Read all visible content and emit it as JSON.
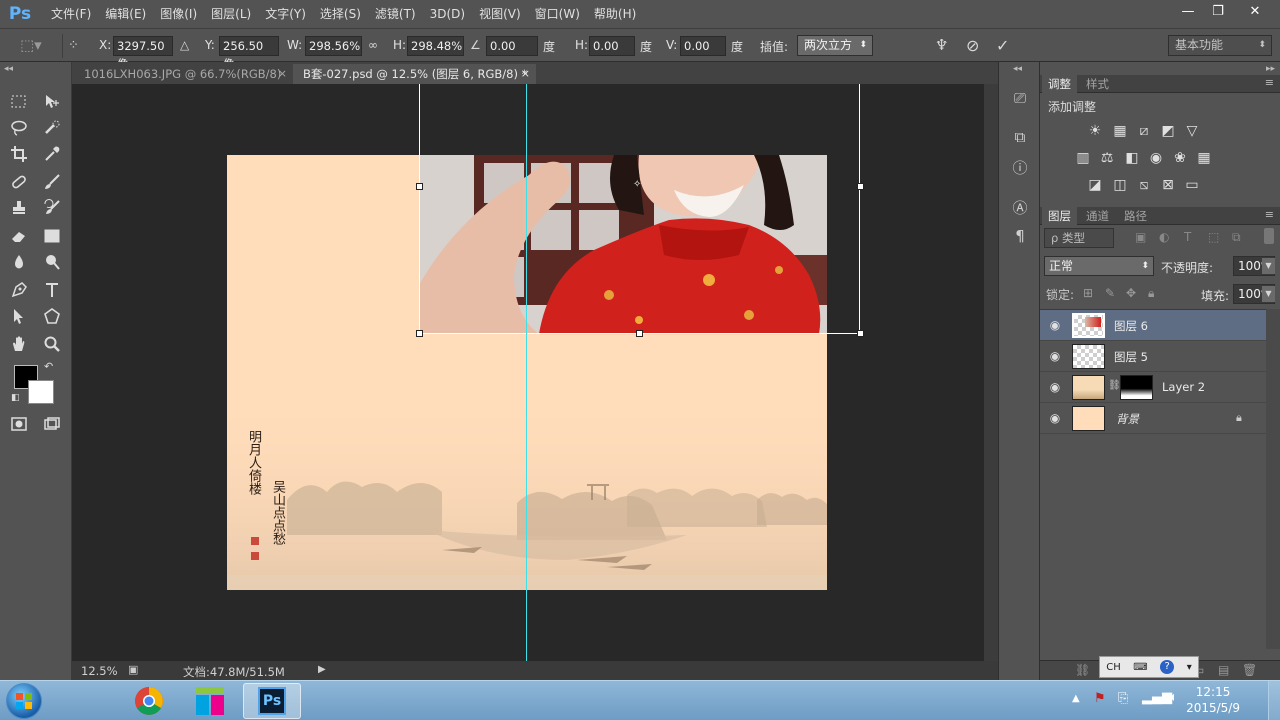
{
  "app": {
    "logo": "Ps",
    "menus": [
      "文件(F)",
      "编辑(E)",
      "图像(I)",
      "图层(L)",
      "文字(Y)",
      "选择(S)",
      "滤镜(T)",
      "3D(D)",
      "视图(V)",
      "窗口(W)",
      "帮助(H)"
    ],
    "window_controls": {
      "minimize": "—",
      "restore": "❐",
      "close": "✕"
    }
  },
  "options_bar": {
    "x_label": "X:",
    "x_value": "3297.50 像",
    "y_label": "Y:",
    "y_value": "256.50 像",
    "w_label": "W:",
    "w_value": "298.56%",
    "h_label": "H:",
    "h_value": "298.48%",
    "angle_value": "0.00",
    "angle_unit": "度",
    "hskew_label": "H:",
    "hskew_value": "0.00",
    "hskew_unit": "度",
    "vskew_label": "V:",
    "vskew_value": "0.00",
    "vskew_unit": "度",
    "interp_label": "插值:",
    "interp_value": "两次立方",
    "workspace": "基本功能"
  },
  "tabs": [
    {
      "label": "1016LXH063.JPG @ 66.7%(RGB/8)",
      "close": "×",
      "active": false
    },
    {
      "label": "B套-027.psd @ 12.5% (图层 6, RGB/8) *",
      "close": "×",
      "active": true
    }
  ],
  "document": {
    "calligraphy_left": "明月人倚楼",
    "calligraphy_right": "吴山点点愁"
  },
  "status": {
    "zoom": "12.5%",
    "doc_size": "文档:47.8M/51.5M"
  },
  "adjustments_panel": {
    "tabs": [
      "调整",
      "样式"
    ],
    "title": "添加调整"
  },
  "layers_panel": {
    "tabs": [
      "图层",
      "通道",
      "路径"
    ],
    "filter_label": "ρ 类型",
    "blend_mode": "正常",
    "opacity_label": "不透明度:",
    "opacity_value": "100%",
    "lock_label": "锁定:",
    "fill_label": "填充:",
    "fill_value": "100%",
    "layers": [
      {
        "name": "图层 6",
        "selected": true
      },
      {
        "name": "图层 5",
        "selected": false
      },
      {
        "name": "Layer 2",
        "selected": false
      },
      {
        "name": "背景",
        "selected": false
      }
    ]
  },
  "taskbar": {
    "time": "12:15",
    "date": "2015/5/9",
    "ime": "CH"
  }
}
